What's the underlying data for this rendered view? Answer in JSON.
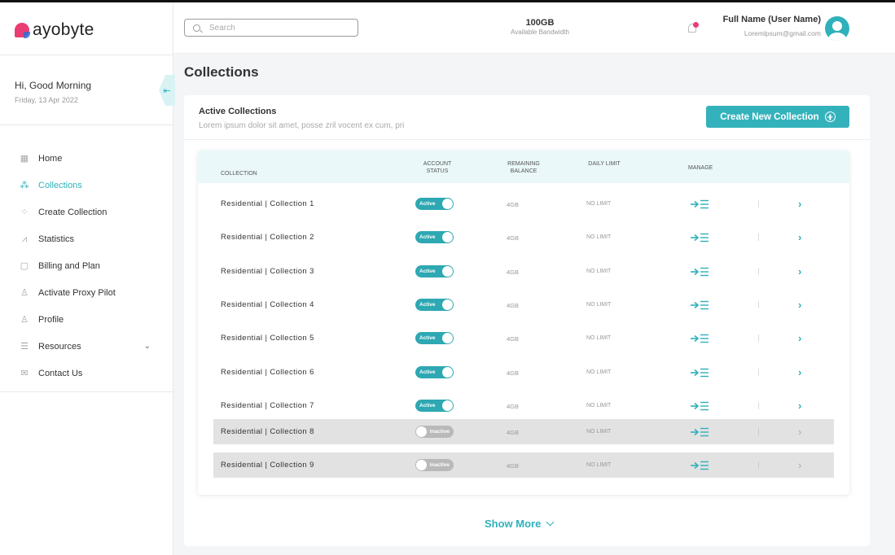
{
  "brand": {
    "name": "ayobyte"
  },
  "greeting": {
    "title": "Hi, Good Morning",
    "date": "Friday, 13 Apr 2022"
  },
  "sidebar": {
    "items": [
      {
        "label": "Home",
        "icon": "home-icon",
        "glyph": "▦",
        "active": false
      },
      {
        "label": "Collections",
        "icon": "collections-icon",
        "glyph": "⁂",
        "active": true
      },
      {
        "label": "Create Collection",
        "icon": "create-collection-icon",
        "glyph": "⁘",
        "active": false
      },
      {
        "label": "Statistics",
        "icon": "statistics-icon",
        "glyph": "⩘",
        "active": false
      },
      {
        "label": "Billing and Plan",
        "icon": "billing-icon",
        "glyph": "▢",
        "active": false
      },
      {
        "label": "Activate Proxy Pilot",
        "icon": "proxy-pilot-icon",
        "glyph": "♙",
        "active": false
      },
      {
        "label": "Profile",
        "icon": "profile-icon",
        "glyph": "♙",
        "active": false
      },
      {
        "label": "Resources",
        "icon": "resources-icon",
        "glyph": "☰",
        "active": false,
        "has_submenu": true
      },
      {
        "label": "Contact Us",
        "icon": "mail-icon",
        "glyph": "✉",
        "active": false
      }
    ]
  },
  "header": {
    "search_placeholder": "Search",
    "bandwidth_value": "100GB",
    "bandwidth_label": "Available Bandwidth",
    "user_name": "Full Name (User Name)",
    "user_email": "Loremlpsum@gmail.com"
  },
  "main": {
    "title": "Collections",
    "card_title": "Active Collections",
    "card_subtitle": "Lorem ipsum dolor sit amet, posse zril vocent ex cum, pri",
    "create_button": "Create New Collection",
    "show_more": "Show More"
  },
  "table": {
    "headers": {
      "collection": "COLLECTION",
      "account_status": "ACCOUNT STATUS",
      "remaining_balance": "REMAINING BALANCE",
      "daily_limit": "DAILY LIMIT",
      "manage": "MANAGE"
    },
    "rows": [
      {
        "name": "Residential | Collection 1",
        "status": "Active",
        "active": true,
        "balance": "4GB",
        "limit": "NO LIMIT"
      },
      {
        "name": "Residential | Collection 2",
        "status": "Active",
        "active": true,
        "balance": "4GB",
        "limit": "NO LIMIT"
      },
      {
        "name": "Residential | Collection 3",
        "status": "Active",
        "active": true,
        "balance": "4GB",
        "limit": "NO LIMIT"
      },
      {
        "name": "Residential | Collection 4",
        "status": "Active",
        "active": true,
        "balance": "4GB",
        "limit": "NO LIMIT"
      },
      {
        "name": "Residential | Collection 5",
        "status": "Active",
        "active": true,
        "balance": "4GB",
        "limit": "NO LIMIT"
      },
      {
        "name": "Residential | Collection 6",
        "status": "Active",
        "active": true,
        "balance": "4GB",
        "limit": "NO LIMIT"
      },
      {
        "name": "Residential | Collection 7",
        "status": "Active",
        "active": true,
        "balance": "4GB",
        "limit": "NO LIMIT"
      },
      {
        "name": "Residential | Collection 8",
        "status": "Inactive",
        "active": false,
        "balance": "4GB",
        "limit": "NO LIMIT"
      },
      {
        "name": "Residential | Collection 9",
        "status": "Inactive",
        "active": false,
        "balance": "4GB",
        "limit": "NO LIMIT"
      }
    ]
  },
  "colors": {
    "accent": "#2fb1bb",
    "brand_pink": "#ea3d73",
    "inactive_row": "#e2e2e2"
  }
}
